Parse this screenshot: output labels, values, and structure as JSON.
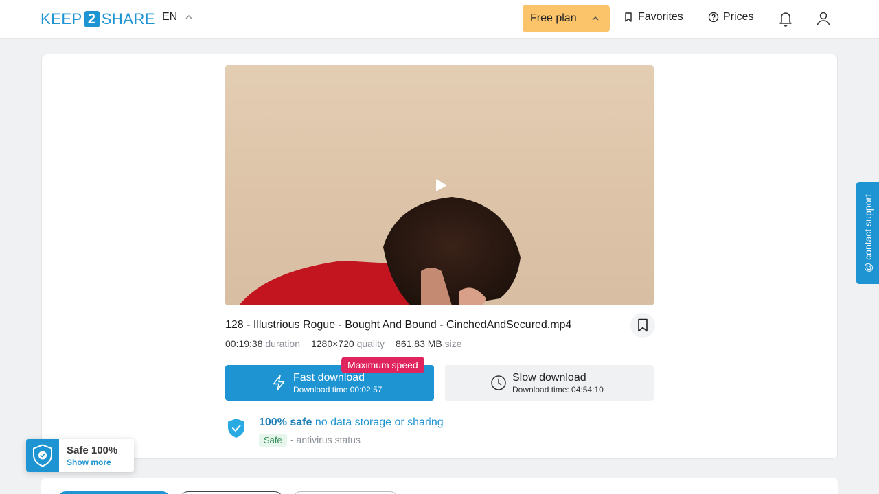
{
  "header": {
    "logo_left": "KEEP",
    "logo_mid": "2",
    "logo_right": "SHARE",
    "language": "EN",
    "plan_label": "Free plan",
    "favorites_label": "Favorites",
    "prices_label": "Prices"
  },
  "file": {
    "title": "128 - Illustrious Rogue - Bought And Bound - CinchedAndSecured.mp4",
    "duration_value": "00:19:38",
    "duration_label": "duration",
    "quality_value": "1280×720",
    "quality_label": "quality",
    "size_value": "861.83 MB",
    "size_label": "size"
  },
  "download": {
    "max_speed_badge": "Maximum speed",
    "fast_label": "Fast download",
    "fast_time": "Download time 00:02:57",
    "slow_label": "Slow download",
    "slow_time": "Download time: 04:54:10"
  },
  "security": {
    "safe_strong": "100% safe",
    "safe_rest": "no data storage or sharing",
    "safe_tag": "Safe",
    "antivirus_text": "- antivirus status"
  },
  "support": {
    "label": "@ contact support"
  },
  "safe_widget": {
    "title": "Safe 100%",
    "link": "Show more"
  },
  "colors": {
    "accent": "#1e94d2",
    "plan": "#fbc46a",
    "badge": "#e0245e"
  }
}
